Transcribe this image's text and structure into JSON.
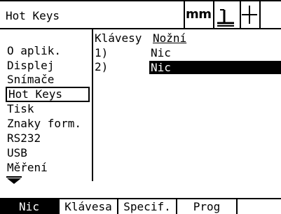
{
  "header": {
    "title": "Hot Keys",
    "unit": "mm",
    "datum_icon": "datum-tool-icon",
    "crosshair_icon": "crosshair-icon"
  },
  "menu": {
    "items": [
      {
        "label": "O aplik."
      },
      {
        "label": "Displej"
      },
      {
        "label": "Snímače"
      },
      {
        "label": "Hot Keys"
      },
      {
        "label": "Tisk"
      },
      {
        "label": "Znaky form."
      },
      {
        "label": "RS232"
      },
      {
        "label": "USB"
      },
      {
        "label": "Měření"
      }
    ],
    "selected_index": 3,
    "more_icon": "down-arrow-icon"
  },
  "content": {
    "heading_prefix": "Klávesy",
    "heading_keyword": "Nožní",
    "rows": [
      {
        "index": "1)",
        "value": "Nic"
      },
      {
        "index": "2)",
        "value": "Nic"
      }
    ]
  },
  "softkeys": [
    {
      "label": "Nic"
    },
    {
      "label": "Klávesa"
    },
    {
      "label": "Specif."
    },
    {
      "label": "Prog"
    },
    {
      "label": ""
    }
  ]
}
